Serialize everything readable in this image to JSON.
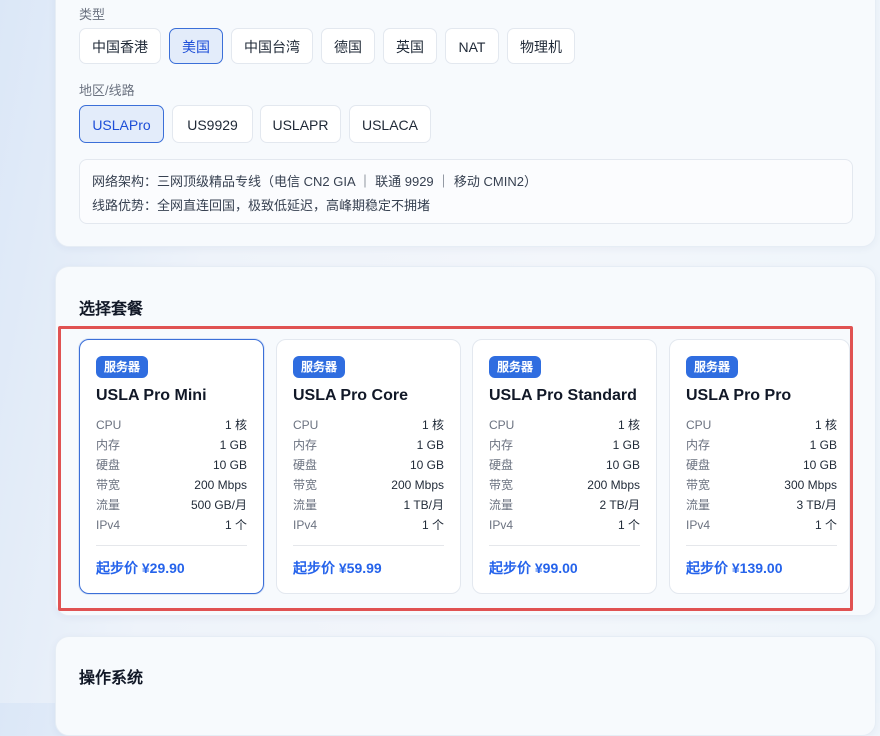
{
  "type_section": {
    "label": "类型",
    "options": [
      "中国香港",
      "美国",
      "中国台湾",
      "德国",
      "英国",
      "NAT",
      "物理机"
    ],
    "selected": "美国"
  },
  "region_section": {
    "label": "地区/线路",
    "options": [
      "USLAPro",
      "US9929",
      "USLAPR",
      "USLACA"
    ],
    "selected": "USLAPro"
  },
  "network_info": {
    "architecture": "网络架构：三网顶级精品专线（电信 CN2 GIA ｜ 联通 9929 ｜ 移动 CMIN2）",
    "advantage": "线路优势：全网直连回国，极致低延迟，高峰期稳定不拥堵"
  },
  "plans_section": {
    "title": "选择套餐",
    "plans": [
      {
        "badge": "服务器",
        "name": "USLA Pro Mini",
        "specs": [
          {
            "k": "CPU",
            "v": "1 核"
          },
          {
            "k": "内存",
            "v": "1 GB"
          },
          {
            "k": "硬盘",
            "v": "10 GB"
          },
          {
            "k": "带宽",
            "v": "200 Mbps"
          },
          {
            "k": "流量",
            "v": "500 GB/月"
          },
          {
            "k": "IPv4",
            "v": "1 个"
          }
        ],
        "price": "起步价 ¥29.90",
        "selected": true
      },
      {
        "badge": "服务器",
        "name": "USLA Pro Core",
        "specs": [
          {
            "k": "CPU",
            "v": "1 核"
          },
          {
            "k": "内存",
            "v": "1 GB"
          },
          {
            "k": "硬盘",
            "v": "10 GB"
          },
          {
            "k": "带宽",
            "v": "200 Mbps"
          },
          {
            "k": "流量",
            "v": "1 TB/月"
          },
          {
            "k": "IPv4",
            "v": "1 个"
          }
        ],
        "price": "起步价 ¥59.99",
        "selected": false
      },
      {
        "badge": "服务器",
        "name": "USLA Pro Standard",
        "specs": [
          {
            "k": "CPU",
            "v": "1 核"
          },
          {
            "k": "内存",
            "v": "1 GB"
          },
          {
            "k": "硬盘",
            "v": "10 GB"
          },
          {
            "k": "带宽",
            "v": "200 Mbps"
          },
          {
            "k": "流量",
            "v": "2 TB/月"
          },
          {
            "k": "IPv4",
            "v": "1 个"
          }
        ],
        "price": "起步价 ¥99.00",
        "selected": false
      },
      {
        "badge": "服务器",
        "name": "USLA Pro Pro",
        "specs": [
          {
            "k": "CPU",
            "v": "1 核"
          },
          {
            "k": "内存",
            "v": "1 GB"
          },
          {
            "k": "硬盘",
            "v": "10 GB"
          },
          {
            "k": "带宽",
            "v": "300 Mbps"
          },
          {
            "k": "流量",
            "v": "3 TB/月"
          },
          {
            "k": "IPv4",
            "v": "1 个"
          }
        ],
        "price": "起步价 ¥139.00",
        "selected": false
      }
    ]
  },
  "os_section": {
    "title": "操作系统"
  },
  "colors": {
    "accent": "#2f6de0",
    "price": "#2563eb",
    "highlight_border": "#e05252",
    "selected_chip_bg": "#e3ecfa"
  }
}
